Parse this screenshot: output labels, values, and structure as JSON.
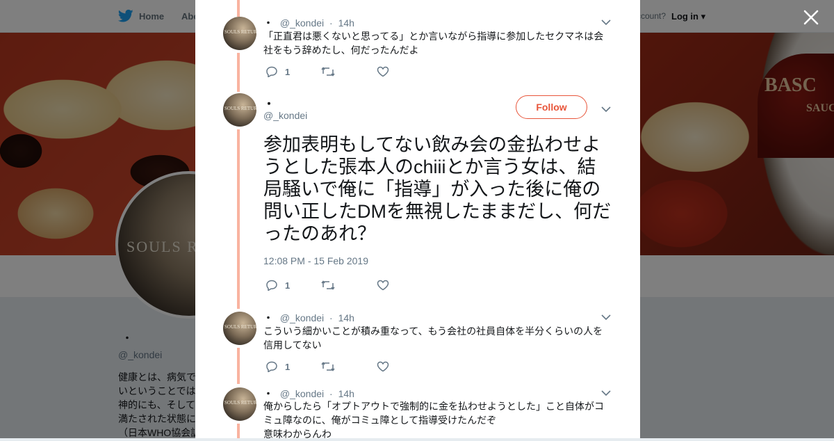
{
  "topbar": {
    "home_label": "Home",
    "about_label": "Abo",
    "account_text": "ccount?",
    "login_label": "Log in"
  },
  "banner": {
    "bottle_text": "BASC",
    "bottle_sub": "SAUCE"
  },
  "profile": {
    "avatar_text": "SOULS RET",
    "name": "・",
    "handle": "@_kondei",
    "bio_lines": [
      "健康とは、病気で",
      "いということでは",
      "神的にも、そして",
      "満たされた状態に",
      "（日本WHO協会訳"
    ]
  },
  "tweets": [
    {
      "name": "・",
      "handle": "@_kondei",
      "time": "14h",
      "text": "「正直君は悪くないと思ってる」とか言いながら指導に参加したセクマネは会社をもう辞めたし、何だったんだよ",
      "reply_count": "1"
    },
    {
      "name": "・",
      "handle": "@_kondei",
      "follow_label": "Follow",
      "text": "参加表明もしてない飲み会の金払わせようとした張本人のchiiiとか言う女は、結局騒いで俺に「指導」が入った後に俺の問い正したDMを無視したままだし、何だったのあれ？",
      "timestamp": "12:08 PM - 15 Feb 2019",
      "reply_count": "1"
    },
    {
      "name": "・",
      "handle": "@_kondei",
      "time": "14h",
      "text": "こういう細かいことが積み重なって、もう会社の社員自体を半分くらいの人を信用してない",
      "reply_count": "1"
    },
    {
      "name": "・",
      "handle": "@_kondei",
      "time": "14h",
      "text": "俺からしたら「オプトアウトで強制的に金を払わせようとした」こと自体がコミュ障なのに、俺がコミュ障として指導受けたんだぞ\n意味わからんわ"
    }
  ],
  "avatar_text": "SOULS RETURN",
  "colors": {
    "accent": "#e8553a",
    "thread_line": "#f9b3a0",
    "twitter_blue": "#1da1f2",
    "muted": "#657786",
    "text": "#14171a"
  },
  "icons": {
    "logo": "twitter-bird-icon",
    "close": "close-icon",
    "reply": "reply-icon",
    "retweet": "retweet-icon",
    "like": "heart-icon",
    "caret": "chevron-down-icon"
  }
}
